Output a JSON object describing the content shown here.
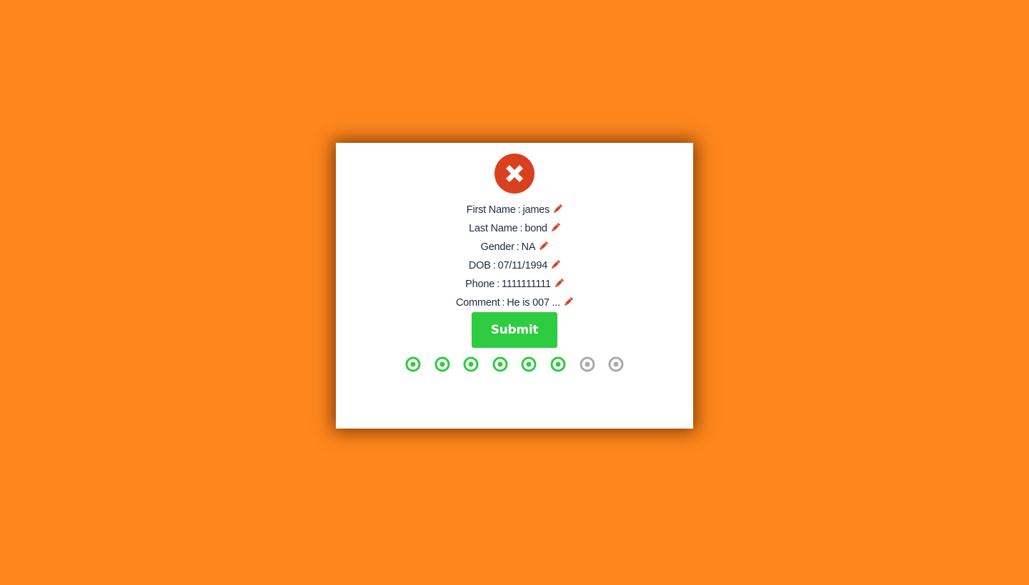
{
  "colors": {
    "background": "#FF861C",
    "close_button": "#D9401F",
    "edit_icon": "#D9401F",
    "submit_button": "#2ECC40",
    "step_complete": "#2ECC40",
    "step_incomplete": "#AAAAAA",
    "text": "#1E2A44"
  },
  "modal": {
    "close_icon": "close-icon",
    "separator": ":",
    "fields": [
      {
        "label": "First Name",
        "value": "james",
        "icon": "pencil-icon"
      },
      {
        "label": "Last Name",
        "value": "bond",
        "icon": "pencil-icon"
      },
      {
        "label": "Gender",
        "value": "NA",
        "icon": "pencil-icon"
      },
      {
        "label": "DOB",
        "value": "07/11/1994",
        "icon": "pencil-icon"
      },
      {
        "label": "Phone",
        "value": "1111111111",
        "icon": "pencil-icon"
      },
      {
        "label": "Comment",
        "value": "He is 007 ...",
        "icon": "pencil-icon"
      }
    ],
    "submit_label": "Submit",
    "steps": [
      {
        "status": "complete"
      },
      {
        "status": "complete"
      },
      {
        "status": "complete"
      },
      {
        "status": "complete"
      },
      {
        "status": "complete"
      },
      {
        "status": "complete"
      },
      {
        "status": "incomplete"
      },
      {
        "status": "incomplete"
      }
    ]
  }
}
